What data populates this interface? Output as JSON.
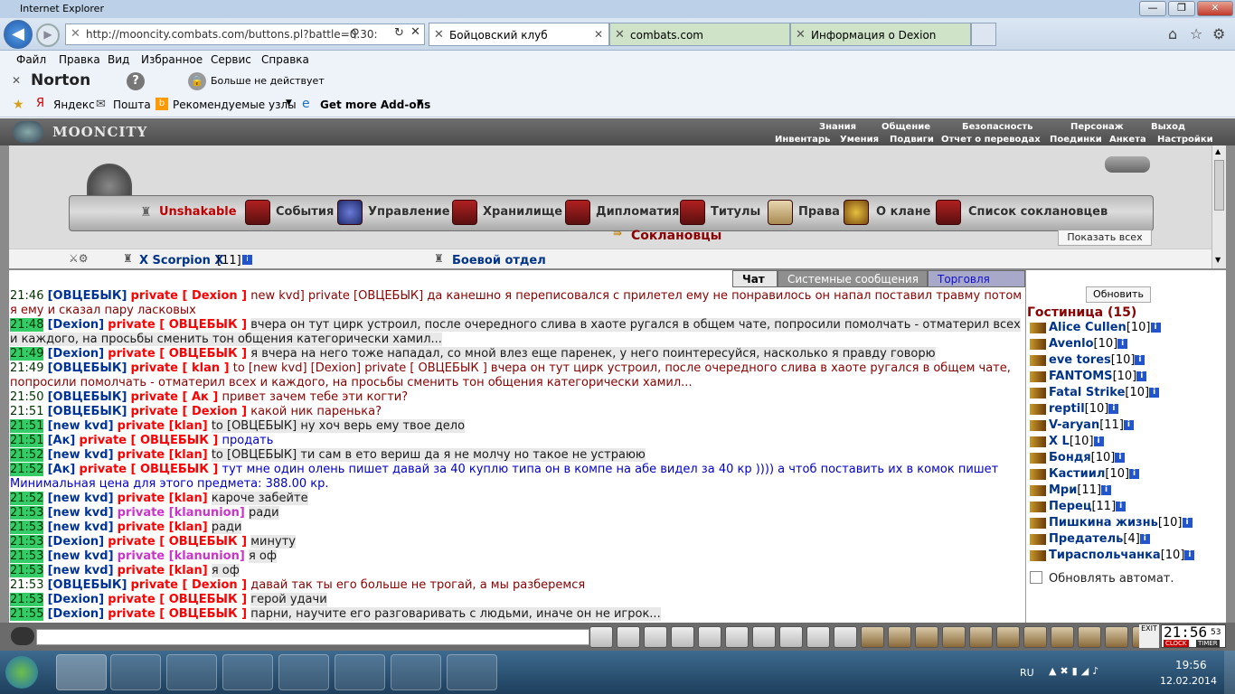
{
  "window": {
    "title": "Internet Explorer",
    "controls": {
      "minimize": "—",
      "restore": "❐",
      "close": "✕"
    }
  },
  "browser": {
    "address": "http://mooncity.combats.com/buttons.pl?battle=0.30:",
    "tabs": [
      {
        "label": "Бойцовский клуб"
      },
      {
        "label": "combats.com"
      },
      {
        "label": "Информация о Dexion"
      }
    ],
    "menu": [
      "Файл",
      "Правка",
      "Вид",
      "Избранное",
      "Сервис",
      "Справка"
    ],
    "norton": {
      "logo": "Norton",
      "status": "Больше не действует"
    },
    "favorites": [
      "Яндекс",
      "Пошта",
      "Рекомендуемые узлы",
      "Get more Add-ons"
    ]
  },
  "site": {
    "logo": "MOONCITY",
    "top_links_row1": [
      "Знания",
      "Общение",
      "Безопасность",
      "Персонаж",
      "Выход"
    ],
    "top_links_row2": [
      "Инвентарь",
      "Умения",
      "Подвиги",
      "Отчет о переводах",
      "Поединки",
      "Анкета",
      "Настройки"
    ],
    "clan_menu": [
      "Unshakable",
      "События",
      "Управление",
      "Хранилище",
      "Дипломатия",
      "Титулы",
      "Права",
      "О клане",
      "Список соклановцев"
    ],
    "section_title": "Соклановцы",
    "show_all": "Показать всех",
    "members_row": [
      {
        "name": "X Scorpion X",
        "level": "[11]"
      },
      {
        "name": "Боевой отдел",
        "level": ""
      }
    ]
  },
  "chat_tabs": [
    "Чат",
    "Системные сообщения",
    "Торговля"
  ],
  "chat": [
    {
      "time": "21:46",
      "hl_time": false,
      "from": "[ОВЦЕБЫК]",
      "pv": "private [ Dexion ]",
      "pvcolor": "red",
      "text": "new kvd] private [ОВЦЕБЫК] да канешно я переписовался с прилетел ему не понравилось он напал поставил травму потом я ему и сказал пару ласковых",
      "tcolor": "mg",
      "hl": false
    },
    {
      "time": "21:48",
      "hl_time": true,
      "from": "[Dexion]",
      "pv": "private [ ОВЦЕБЫК ]",
      "pvcolor": "red",
      "text": "вчера он тут цирк устроил, после очередного слива в хаоте ругался в общем чате, попросили помолчать - отматерил всех и каждого, на просьбы сменить тон общения категорически хамил...",
      "tcolor": "mgb",
      "hl": true
    },
    {
      "time": "21:49",
      "hl_time": true,
      "from": "[Dexion]",
      "pv": "private [ ОВЦЕБЫК ]",
      "pvcolor": "red",
      "text": "я вчера на него тоже нападал, со мной влез еще паренек, у него поинтересуйся, насколько я правду говорю",
      "tcolor": "mgb",
      "hl": true
    },
    {
      "time": "21:49",
      "hl_time": false,
      "from": "[ОВЦЕБЫК]",
      "pv": "private [ klan ]",
      "pvcolor": "red",
      "text": "to [new kvd] [Dexion] private [ ОВЦЕБЫК ] вчера он тут цирк устроил, после очередного слива в хаоте ругался в общем чате, попросили помолчать - отматерил всех и каждого, на просьбы сменить тон общения категорически хамил...",
      "tcolor": "mg",
      "hl": false
    },
    {
      "time": "21:50",
      "hl_time": false,
      "from": "[ОВЦЕБЫК]",
      "pv": "private [ Ак ]",
      "pvcolor": "red",
      "text": "привет зачем тебе эти когти?",
      "tcolor": "mg",
      "hl": false
    },
    {
      "time": "21:51",
      "hl_time": false,
      "from": "[ОВЦЕБЫК]",
      "pv": "private [ Dexion ]",
      "pvcolor": "red",
      "text": "какой ник паренька?",
      "tcolor": "mg",
      "hl": false
    },
    {
      "time": "21:51",
      "hl_time": true,
      "from": "[new kvd]",
      "pv": "private [klan]",
      "pvcolor": "red",
      "text": "to [ОВЦЕБЫК] ну хоч верь ему твое дело",
      "tcolor": "mgb",
      "hl": true
    },
    {
      "time": "21:51",
      "hl_time": true,
      "from": "[Ак]",
      "pv": "private [ ОВЦЕБЫК ]",
      "pvcolor": "red",
      "text": "продать",
      "tcolor": "mgbl",
      "hl": false
    },
    {
      "time": "21:52",
      "hl_time": true,
      "from": "[new kvd]",
      "pv": "private [klan]",
      "pvcolor": "red",
      "text": "to [ОВЦЕБЫК] ти сам в ето вериш да я не молчу но такое не устраюю",
      "tcolor": "mgb",
      "hl": true
    },
    {
      "time": "21:52",
      "hl_time": true,
      "from": "[Ак]",
      "pv": "private [ ОВЦЕБЫК ]",
      "pvcolor": "red",
      "text": "тут мне один олень пишет давай за 40 куплю типа он в компе на абе видел за 40 кр )))) а чтоб поставить их в комок пишет Минимальная цена для этого предмета: 388.00 кр.",
      "tcolor": "mgbl",
      "hl": false
    },
    {
      "time": "21:52",
      "hl_time": true,
      "from": "[new kvd]",
      "pv": "private [klan]",
      "pvcolor": "red",
      "text": "кароче забейте",
      "tcolor": "mgb",
      "hl": true
    },
    {
      "time": "21:53",
      "hl_time": true,
      "from": "[new kvd]",
      "pv": "private [klanunion]",
      "pvcolor": "pink",
      "text": "ради",
      "tcolor": "mgb",
      "hl": true
    },
    {
      "time": "21:53",
      "hl_time": true,
      "from": "[new kvd]",
      "pv": "private [klan]",
      "pvcolor": "red",
      "text": "ради",
      "tcolor": "mgb",
      "hl": true
    },
    {
      "time": "21:53",
      "hl_time": true,
      "from": "[Dexion]",
      "pv": "private [ ОВЦЕБЫК ]",
      "pvcolor": "red",
      "text": "минуту",
      "tcolor": "mgb",
      "hl": true
    },
    {
      "time": "21:53",
      "hl_time": true,
      "from": "[new kvd]",
      "pv": "private [klanunion]",
      "pvcolor": "pink",
      "text": "я оф",
      "tcolor": "mgb",
      "hl": true
    },
    {
      "time": "21:53",
      "hl_time": true,
      "from": "[new kvd]",
      "pv": "private [klan]",
      "pvcolor": "red",
      "text": "я оф",
      "tcolor": "mgb",
      "hl": true
    },
    {
      "time": "21:53",
      "hl_time": false,
      "from": "[ОВЦЕБЫК]",
      "pv": "private [ Dexion ]",
      "pvcolor": "red",
      "text": "давай так ты его больше не трогай, а мы разберемся",
      "tcolor": "mg",
      "hl": false
    },
    {
      "time": "21:53",
      "hl_time": true,
      "from": "[Dexion]",
      "pv": "private [ ОВЦЕБЫК ]",
      "pvcolor": "red",
      "text": "герой удачи",
      "tcolor": "mgb",
      "hl": true
    },
    {
      "time": "21:55",
      "hl_time": true,
      "from": "[Dexion]",
      "pv": "private [ ОВЦЕБЫК ]",
      "pvcolor": "red",
      "text": "парни, научите его разговаривать с людьми, иначе он не игрок...",
      "tcolor": "mgb",
      "hl": true
    }
  ],
  "right_panel": {
    "refresh": "Обновить",
    "title": "Гостиница (15)",
    "auto_refresh": "Обновлять автомат.",
    "users": [
      {
        "name": "Alice Cullen",
        "level": "[10]"
      },
      {
        "name": "Avenlo",
        "level": "[10]"
      },
      {
        "name": "eve tores",
        "level": "[10]"
      },
      {
        "name": "FANTOMS",
        "level": "[10]"
      },
      {
        "name": "Fatal Strike",
        "level": "[10]"
      },
      {
        "name": "reptil",
        "level": "[10]"
      },
      {
        "name": "V-aryan",
        "level": "[11]"
      },
      {
        "name": "X L",
        "level": "[10]"
      },
      {
        "name": "Бондя",
        "level": "[10]"
      },
      {
        "name": "Кастиил",
        "level": "[10]"
      },
      {
        "name": "Мри",
        "level": "[11]"
      },
      {
        "name": "Перец",
        "level": "[11]"
      },
      {
        "name": "Пишкина жизнь",
        "level": "[10]"
      },
      {
        "name": "Предатель",
        "level": "[4]"
      },
      {
        "name": "Тираспольчанка",
        "level": "[10]"
      }
    ]
  },
  "clock": {
    "time": "21:56",
    "seconds": "53",
    "clock_label": "CLOCK",
    "timer_label": "TIMER",
    "exit": "EXIT"
  },
  "taskbar": {
    "lang": "RU",
    "time": "19:56",
    "date": "12.02.2014"
  }
}
